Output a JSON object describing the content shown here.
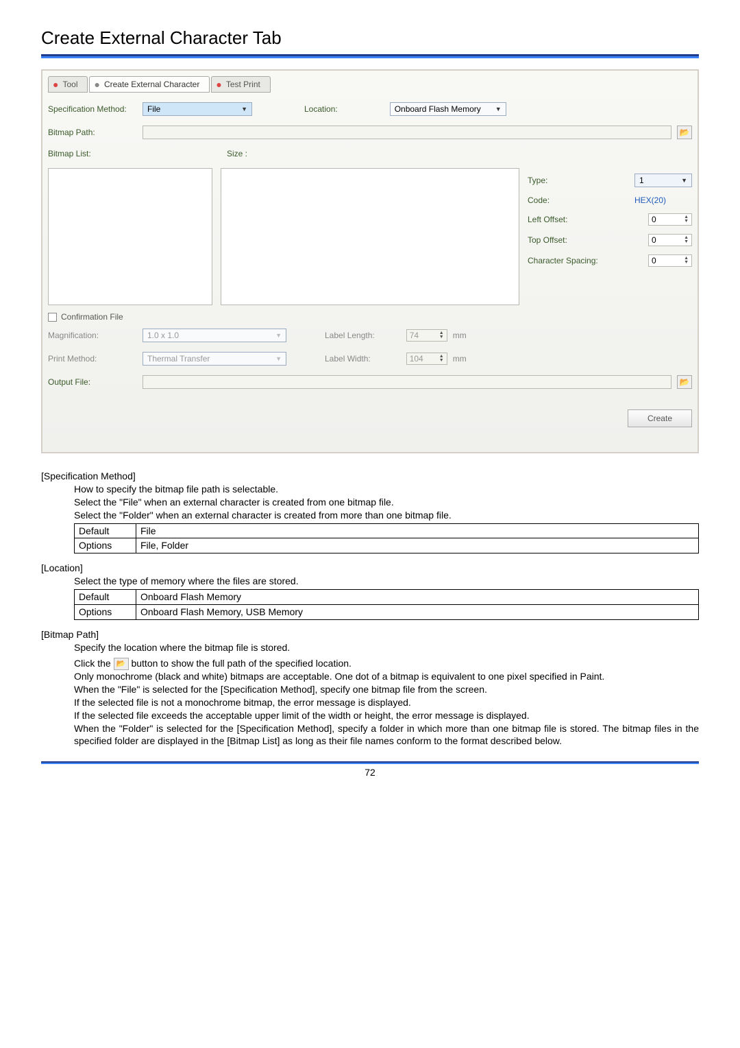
{
  "page": {
    "title": "Create External Character Tab",
    "number": "72"
  },
  "tabs": {
    "tool": "Tool",
    "cec": "Create External Character",
    "test": "Test Print"
  },
  "form": {
    "spec_method_label": "Specification Method:",
    "spec_method_value": "File",
    "location_label": "Location:",
    "location_value": "Onboard Flash Memory",
    "bitmap_path_label": "Bitmap Path:",
    "bitmap_list_label": "Bitmap List:",
    "size_label": "Size :",
    "type_label": "Type:",
    "type_value": "1",
    "code_label": "Code:",
    "code_value": "HEX(20)",
    "left_offset_label": "Left Offset:",
    "left_offset_value": "0",
    "top_offset_label": "Top Offset:",
    "top_offset_value": "0",
    "char_spacing_label": "Character Spacing:",
    "char_spacing_value": "0",
    "confirmation_file_label": "Confirmation File",
    "magnification_label": "Magnification:",
    "magnification_value": "1.0 x 1.0",
    "label_length_label": "Label Length:",
    "label_length_value": "74",
    "print_method_label": "Print Method:",
    "print_method_value": "Thermal Transfer",
    "label_width_label": "Label Width:",
    "label_width_value": "104",
    "mm": "mm",
    "output_file_label": "Output File:",
    "create_button": "Create"
  },
  "doc": {
    "spec_method": {
      "heading": "[Specification Method]",
      "line1": "How to specify the bitmap file path is selectable.",
      "line2": "Select the \"File\" when an external character is created from one bitmap file.",
      "line3": "Select the \"Folder\" when an external character is created from more than one bitmap file.",
      "table_default_label": "Default",
      "table_default_value": "File",
      "table_options_label": "Options",
      "table_options_value": "File, Folder"
    },
    "location": {
      "heading": "[Location]",
      "line1": "Select the type of memory where the files are stored.",
      "table_default_label": "Default",
      "table_default_value": "Onboard Flash Memory",
      "table_options_label": "Options",
      "table_options_value": "Onboard Flash Memory, USB Memory"
    },
    "bitmap_path": {
      "heading": "[Bitmap Path]",
      "line1": "Specify the location where the bitmap file is stored.",
      "line2a": "Click the ",
      "line2b": " button to show the full path of the specified location.",
      "line3": "Only monochrome (black and white) bitmaps are acceptable. One dot of a bitmap is equivalent to one pixel specified in Paint.",
      "line4": "When the \"File\" is selected for the [Specification Method], specify one bitmap file from the screen.",
      "line5": "If the selected file is not a monochrome bitmap, the error message is displayed.",
      "line6": "If the selected file exceeds the acceptable upper limit of the width or height, the error message is displayed.",
      "line7": "When the \"Folder\" is selected for the [Specification Method], specify a folder in which more than one bitmap file is stored.  The bitmap files in the specified folder are displayed in the [Bitmap List] as long as their file names conform to the format described below."
    }
  }
}
